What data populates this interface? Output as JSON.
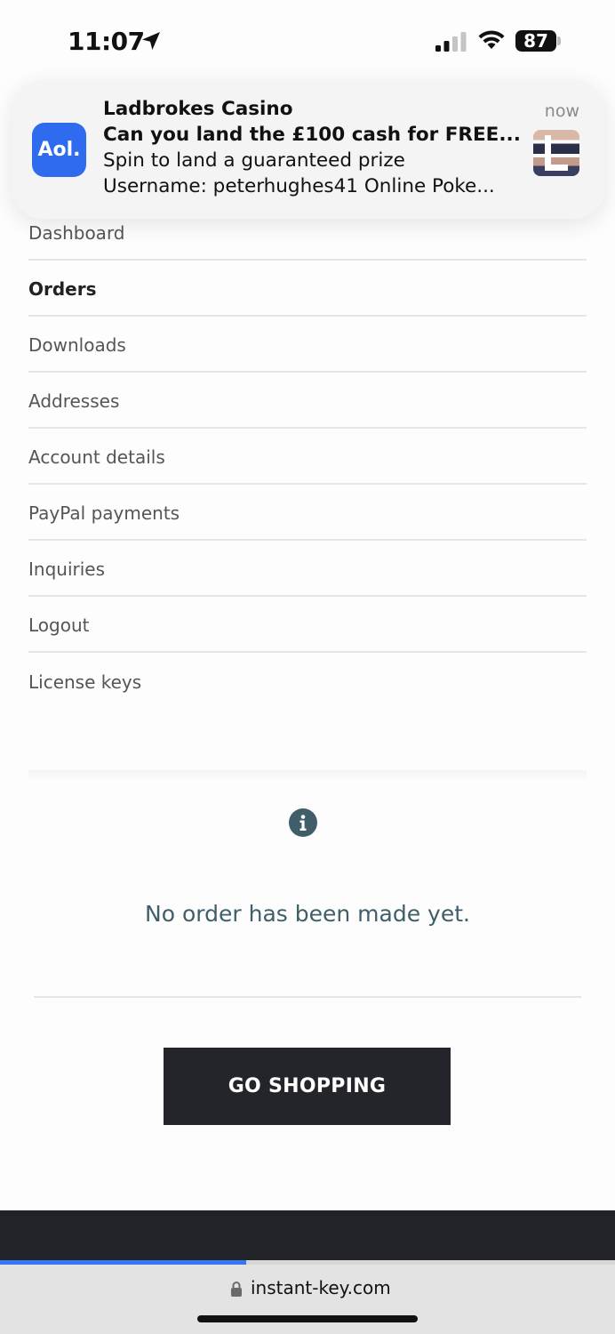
{
  "status_bar": {
    "time": "11:07",
    "battery": "87"
  },
  "notification": {
    "app_logo": "Aol.",
    "title": "Ladbrokes Casino",
    "headline": "Can you land the £100 cash for FREE...",
    "body_line1": "Spin to land a guaranteed prize",
    "body_line2": "Username: peterhughes41 Online Poke...",
    "time": "now"
  },
  "account_nav": {
    "items": [
      {
        "label": "Dashboard",
        "active": false
      },
      {
        "label": "Orders",
        "active": true
      },
      {
        "label": "Downloads",
        "active": false
      },
      {
        "label": "Addresses",
        "active": false
      },
      {
        "label": "Account details",
        "active": false
      },
      {
        "label": "PayPal payments",
        "active": false
      },
      {
        "label": "Inquiries",
        "active": false
      },
      {
        "label": "Logout",
        "active": false
      },
      {
        "label": "License keys",
        "active": false
      }
    ]
  },
  "orders": {
    "empty_message": "No order has been made yet.",
    "cta_label": "GO SHOPPING"
  },
  "browser": {
    "url": "instant-key.com",
    "load_progress": 0.4
  },
  "colors": {
    "aol_blue": "#2e6bee",
    "notice_text": "#3f5e6a",
    "button_bg": "#24252a",
    "progress_blue": "#3478f6"
  },
  "icons": [
    "location-arrow-icon",
    "cellular-signal-icon",
    "wifi-icon",
    "battery-icon",
    "info-icon",
    "lock-icon"
  ]
}
